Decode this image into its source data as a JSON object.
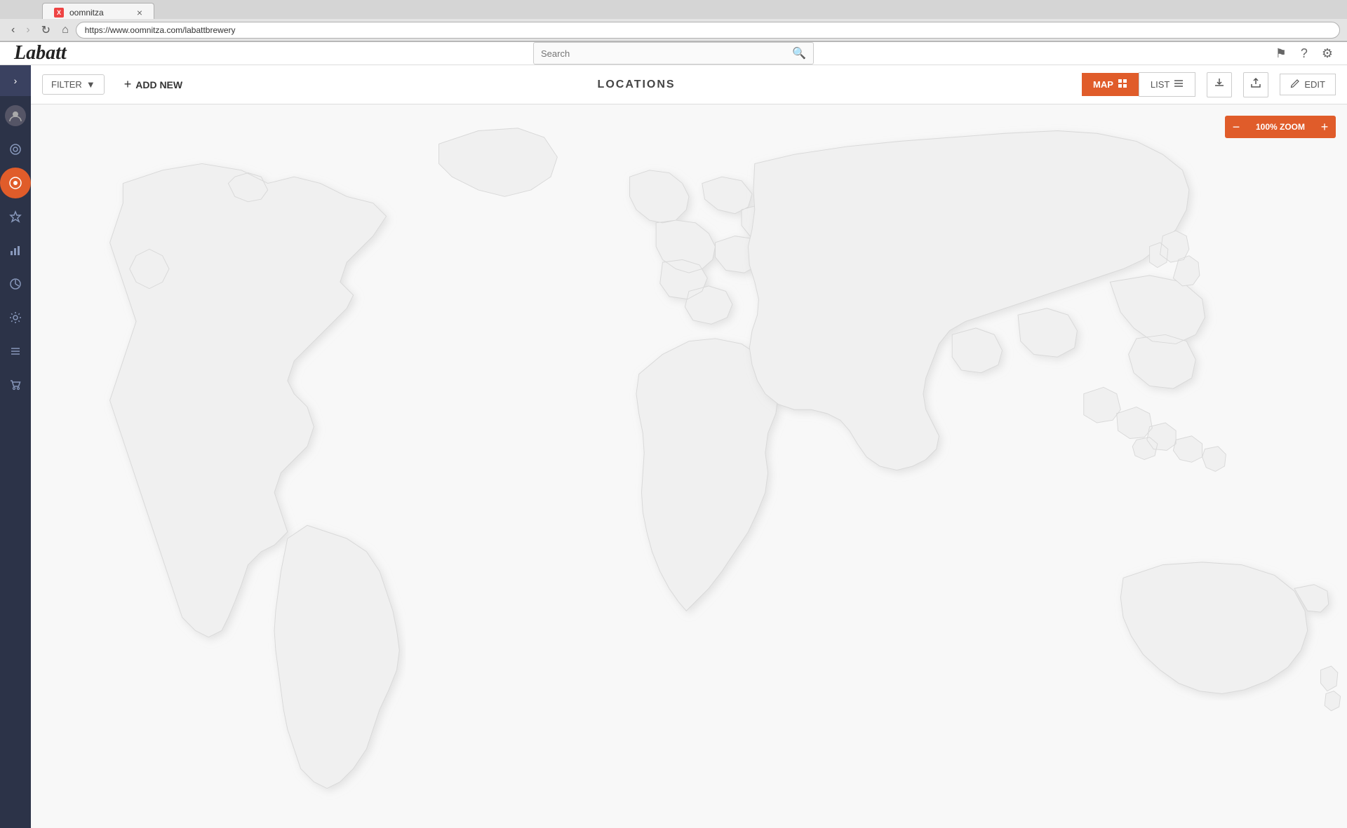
{
  "browser": {
    "tab_title": "oomnitza",
    "tab_favicon": "X",
    "url": "https://www.oomnitza.com/labattbrewery",
    "nav_back_disabled": false,
    "nav_forward_disabled": true
  },
  "header": {
    "logo": "Labatt",
    "search_placeholder": "Search",
    "icons": {
      "flag": "⚑",
      "help": "?",
      "settings": "⚙"
    }
  },
  "sidebar": {
    "expand_icon": "›",
    "items": [
      {
        "id": "avatar",
        "icon": "👤",
        "active": false
      },
      {
        "id": "dashboard",
        "icon": "◎",
        "active": false
      },
      {
        "id": "locations",
        "icon": "⊙",
        "active": true
      },
      {
        "id": "star",
        "icon": "★",
        "active": false
      },
      {
        "id": "chart",
        "icon": "📊",
        "active": false
      },
      {
        "id": "circle",
        "icon": "◉",
        "active": false
      },
      {
        "id": "cog",
        "icon": "✦",
        "active": false
      },
      {
        "id": "list",
        "icon": "≡",
        "active": false
      },
      {
        "id": "cart",
        "icon": "🛒",
        "active": false
      }
    ]
  },
  "toolbar": {
    "filter_label": "FILTER",
    "filter_dropdown_icon": "▼",
    "add_new_label": "ADD NEW",
    "add_icon": "+",
    "page_title": "LOCATIONS",
    "map_label": "MAP",
    "list_label": "LIST",
    "download_icon": "⬇",
    "share_icon": "⬆",
    "edit_label": "EDIT",
    "edit_icon": "✏"
  },
  "map": {
    "zoom_level": "100% ZOOM",
    "zoom_minus": "−",
    "zoom_plus": "+"
  }
}
